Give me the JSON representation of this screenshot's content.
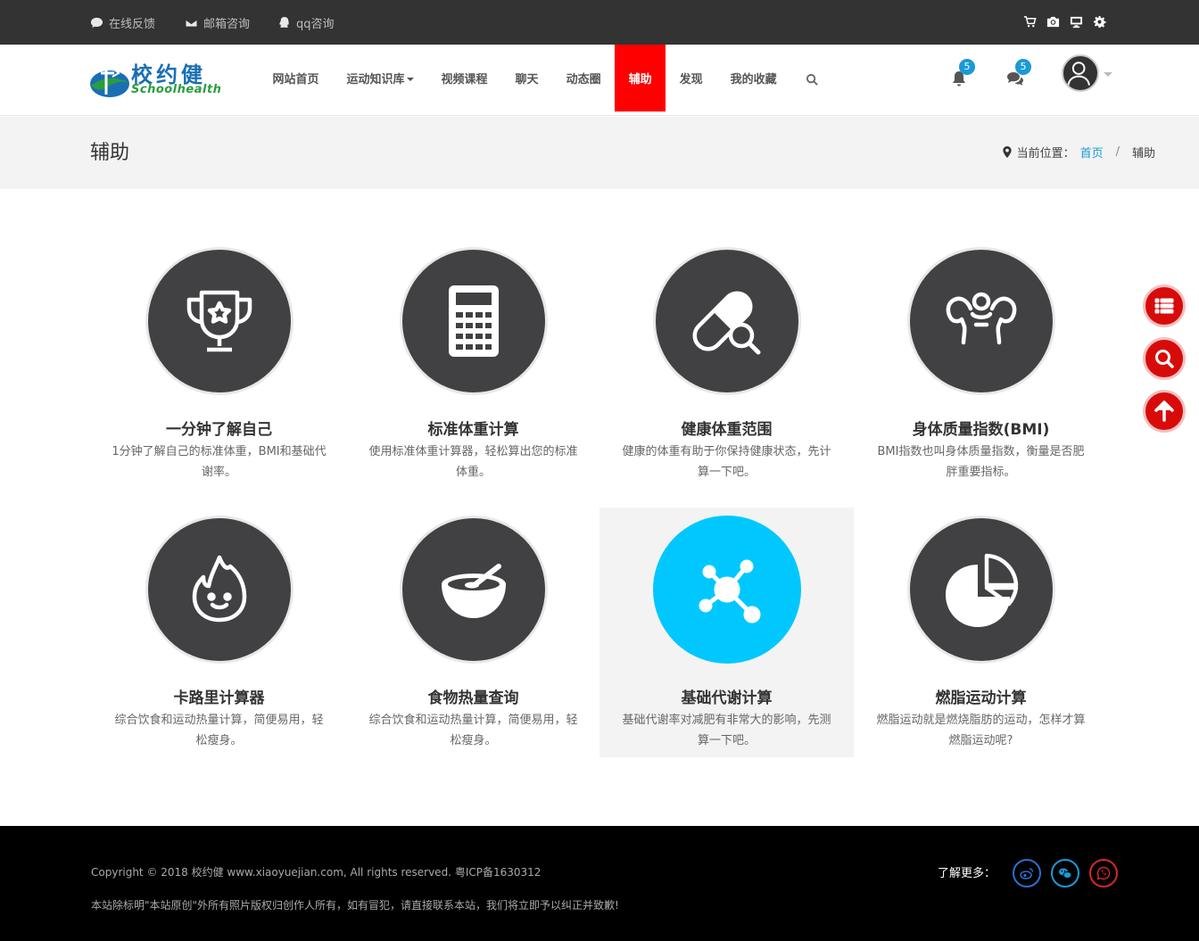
{
  "topbar": {
    "feedback": "在线反馈",
    "email": "邮箱咨询",
    "qq": "qq咨询",
    "right_icons": [
      "cart-icon",
      "camera-icon",
      "monitor-icon",
      "gear-icon"
    ]
  },
  "logo": {
    "zh": "校约健",
    "en": "Schoolhealth"
  },
  "nav": {
    "items": [
      "网站首页",
      "运动知识库",
      "视频课程",
      "聊天",
      "动态圈",
      "辅助",
      "发现",
      "我的收藏"
    ],
    "active": "辅助",
    "notifications": "5",
    "messages": "5"
  },
  "page": {
    "title": "辅助",
    "breadcrumb_label": "当前位置：",
    "breadcrumb_home": "首页",
    "breadcrumb_sep": "/",
    "breadcrumb_current": "辅助"
  },
  "tools": [
    {
      "title": "一分钟了解自己",
      "desc": "1分钟了解自己的标准体重，BMI和基础代谢率。",
      "icon": "trophy-icon"
    },
    {
      "title": "标准体重计算",
      "desc": "使用标准体重计算器，轻松算出您的标准体重。",
      "icon": "calculator-icon"
    },
    {
      "title": "健康体重范围",
      "desc": "健康的体重有助于你保持健康状态，先计算一下吧。",
      "icon": "pill-search-icon"
    },
    {
      "title": "身体质量指数(BMI)",
      "desc": "BMI指数也叫身体质量指数，衡量是否肥胖重要指标。",
      "icon": "muscle-icon"
    },
    {
      "title": "卡路里计算器",
      "desc": "综合饮食和运动热量计算，简便易用，轻松瘦身。",
      "icon": "flame-icon"
    },
    {
      "title": "食物热量查询",
      "desc": "综合饮食和运动热量计算，简便易用，轻松瘦身。",
      "icon": "bowl-icon"
    },
    {
      "title": "基础代谢计算",
      "desc": "基础代谢率对减肥有非常大的影响，先测算一下吧。",
      "icon": "molecule-icon"
    },
    {
      "title": "燃脂运动计算",
      "desc": "燃脂运动就是燃烧脂肪的运动，怎样才算燃脂运动呢?",
      "icon": "pie-chart-icon"
    }
  ],
  "footer": {
    "copyright": "Copyright © 2018 校约健 www.xiaoyuejian.com, All rights reserved. 粤ICP备1630312",
    "notice": "本站除标明\"本站原创\"外所有照片版权归创作人所有，如有冒犯，请直接联系本站，我们将立即予以纠正并致歉!",
    "more": "了解更多："
  },
  "colors": {
    "accent_red": "#fe0000",
    "link_blue": "#1a9ad6",
    "circle_dark": "#414143",
    "circle_highlight": "#00c8ff"
  }
}
